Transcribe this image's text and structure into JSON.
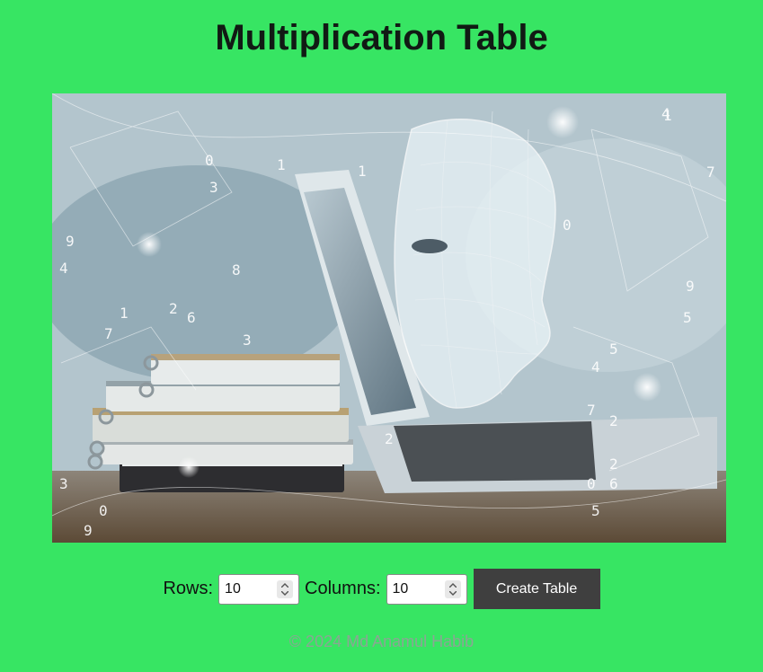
{
  "header": {
    "title": "Multiplication Table"
  },
  "hero": {
    "icon": "ai-laptop-books-image",
    "digits": [
      "1",
      "0",
      "9",
      "2",
      "7",
      "4",
      "5",
      "3",
      "8",
      "6",
      "1",
      "0",
      "2",
      "9",
      "7",
      "4",
      "5",
      "3",
      "1",
      "0",
      "2",
      "6",
      "9",
      "7",
      "4",
      "0",
      "2",
      "5",
      "1",
      "3"
    ]
  },
  "controls": {
    "rows_label": "Rows:",
    "rows_value": "10",
    "columns_label": "Columns:",
    "columns_value": "10",
    "create_label": "Create Table"
  },
  "footer": {
    "copyright": "© 2024 Md Anamul Habib"
  },
  "colors": {
    "background": "#37e563",
    "button": "#3f3f3f",
    "footer_text": "#8aa694"
  }
}
